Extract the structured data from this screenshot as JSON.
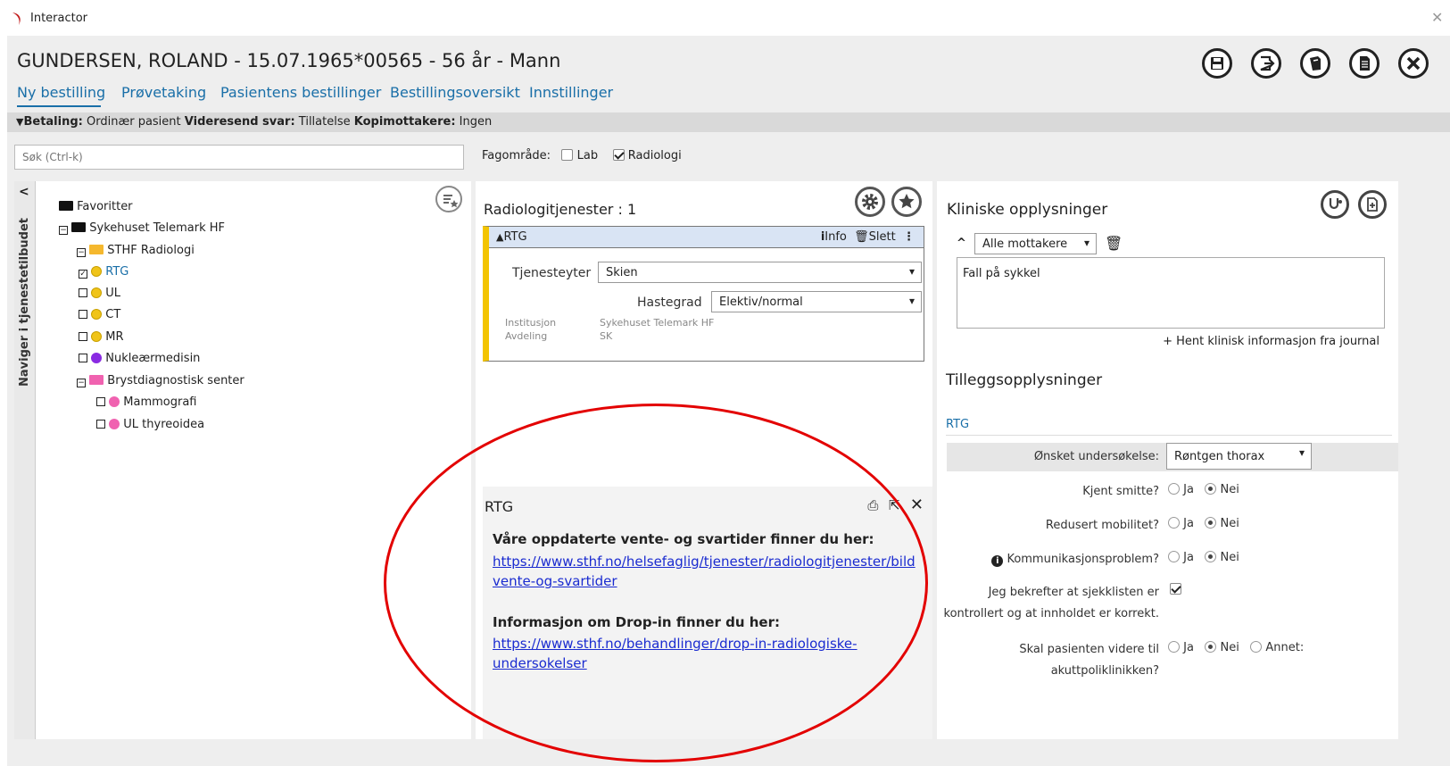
{
  "app": {
    "title": "Interactor"
  },
  "patient": {
    "header": "GUNDERSEN, ROLAND - 15.07.1965*00565 - 56 år - Mann"
  },
  "header_icons": [
    "save-icon",
    "export-icon",
    "book-icon",
    "document-icon",
    "close-icon"
  ],
  "tabs": [
    "Ny bestilling",
    "Prøvetaking",
    "Pasientens bestillinger",
    "Bestillingsoversikt",
    "Innstillinger"
  ],
  "infobar": {
    "betaling_label": "Betaling:",
    "betaling_value": "Ordinær pasient",
    "videresend_label": "Videresend svar:",
    "videresend_value": "Tillatelse",
    "kopi_label": "Kopimottakere:",
    "kopi_value": "Ingen"
  },
  "search": {
    "placeholder": "Søk (Ctrl-k)"
  },
  "fagomrade": {
    "label": "Fagområde:",
    "lab": "Lab",
    "radiologi": "Radiologi"
  },
  "sidebar_tab": "Naviger i tjenestetilbudet",
  "tree": {
    "favoritter": "Favoritter",
    "sykehuset": "Sykehuset Telemark HF",
    "sthf_radiologi": "STHF Radiologi",
    "rtg": "RTG",
    "ul": "UL",
    "ct": "CT",
    "mr": "MR",
    "nukleaer": "Nukleærmedisin",
    "bryst": "Brystdiagnostisk senter",
    "mammografi": "Mammografi",
    "ul_thyreoidea": "UL thyreoidea"
  },
  "mid": {
    "title": "Radiologitjenester : 1",
    "card": {
      "name": "RTG",
      "info": "Info",
      "slett": "Slett",
      "tjenesteyter_label": "Tjenesteyter",
      "tjenesteyter_value": "Skien",
      "hastegrad_label": "Hastegrad",
      "hastegrad_value": "Elektiv/normal",
      "institusjon_label": "Institusjon",
      "institusjon_value": "Sykehuset Telemark HF",
      "avdeling_label": "Avdeling",
      "avdeling_value": "SK"
    },
    "popup": {
      "title": "RTG",
      "line1": "Våre oppdaterte vente- og svartider finner du her:",
      "link1a": "https://www.sthf.no/helsefaglig/tjenester/radiologitjenester/bild",
      "link1b": "vente-og-svartider",
      "line2": "Informasjon om Drop-in finner du her:",
      "link2a": "https://www.sthf.no/behandlinger/drop-in-radiologiske-",
      "link2b": "undersokelser"
    }
  },
  "right": {
    "kliniske_title": "Kliniske opplysninger",
    "mottakere": "Alle mottakere",
    "clinical_text": "Fall på sykkel",
    "hent": "+ Hent klinisk informasjon fra journal",
    "tillegg_title": "Tilleggsopplysninger",
    "rtg_label": "RTG",
    "onsket_label": "Ønsket undersøkelse:",
    "onsket_value": "Røntgen thorax",
    "q_smitte": "Kjent smitte?",
    "q_mobilitet": "Redusert mobilitet?",
    "q_kommunikasjon": "Kommunikasjonsproblem?",
    "q_bekrefter1": "Jeg bekrefter at sjekklisten er",
    "q_bekrefter2": "kontrollert og at innholdet er korrekt.",
    "q_akutt1": "Skal pasienten videre til",
    "q_akutt2": "akuttpoliklinikken?",
    "ja": "Ja",
    "nei": "Nei",
    "annet": "Annet:"
  }
}
